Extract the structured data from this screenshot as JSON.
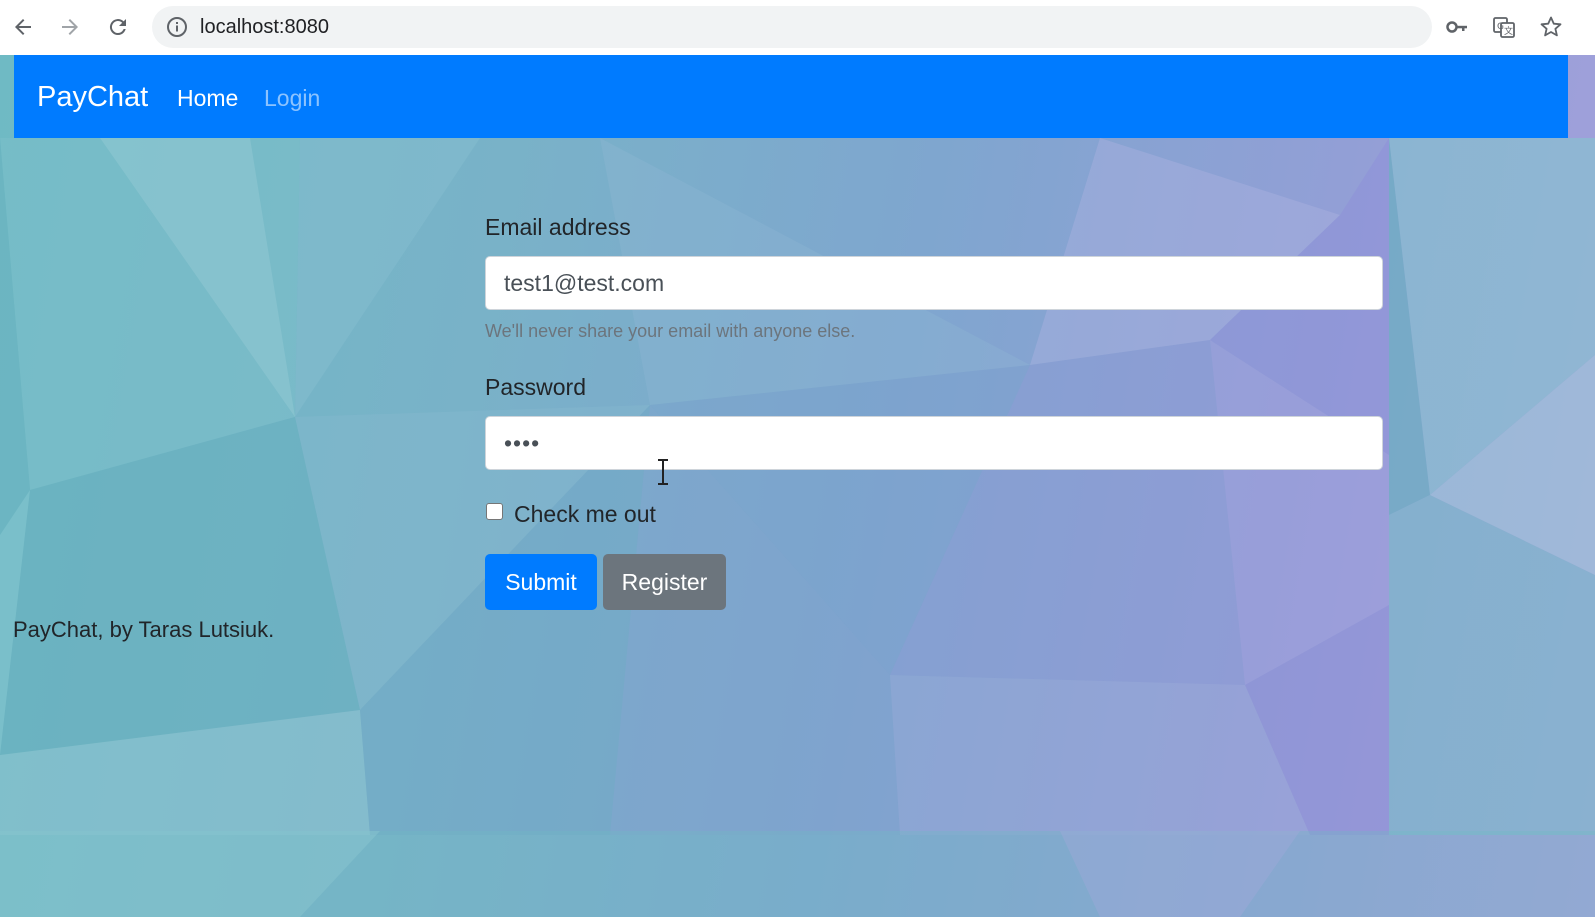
{
  "browser": {
    "url": "localhost:8080",
    "icons": {
      "back": "back-arrow-icon",
      "forward": "forward-arrow-icon",
      "reload": "reload-icon",
      "site_info": "info-icon",
      "password_key": "key-icon",
      "translate": "translate-icon",
      "bookmark": "star-icon"
    }
  },
  "navbar": {
    "brand": "PayChat",
    "links": [
      {
        "label": "Home",
        "active": true
      },
      {
        "label": "Login",
        "active": false
      }
    ],
    "background": "#007bff"
  },
  "form": {
    "email_label": "Email address",
    "email_value": "test1@test.com",
    "email_help": "We'll never share your email with anyone else.",
    "password_label": "Password",
    "password_value": "••••",
    "checkbox_label": "Check me out",
    "checkbox_checked": false,
    "submit_label": "Submit",
    "register_label": "Register"
  },
  "footer": {
    "text": "PayChat, by Taras Lutsiuk."
  },
  "colors": {
    "primary": "#007bff",
    "secondary": "#6c757d"
  }
}
